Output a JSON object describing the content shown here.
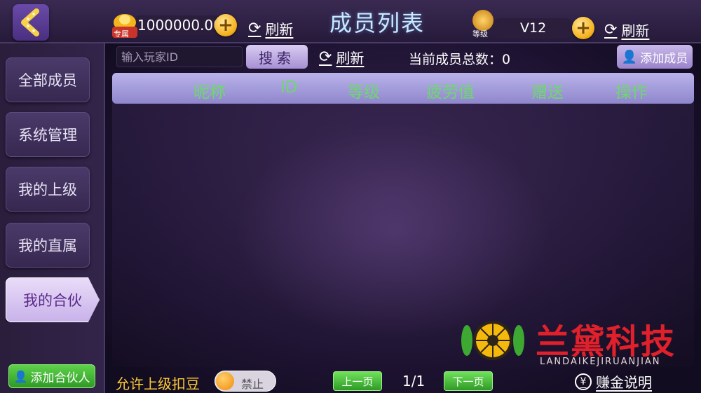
{
  "header": {
    "title": "成员列表",
    "money_tag": "专属",
    "money_value": "1000000.00",
    "refresh_label": "刷新",
    "level_tag": "等级",
    "level_value": "V12",
    "plus_symbol": "+"
  },
  "sidebar": {
    "items": [
      {
        "label": "全部成员"
      },
      {
        "label": "系统管理"
      },
      {
        "label": "我的上级"
      },
      {
        "label": "我的直属"
      },
      {
        "label": "我的合伙"
      }
    ],
    "active_index": 4
  },
  "search": {
    "placeholder": "输入玩家ID",
    "button_label": "搜索",
    "refresh_label": "刷新",
    "member_count_label": "当前成员总数：0",
    "add_member_label": "添加成员"
  },
  "table": {
    "columns": [
      "昵称",
      "ID",
      "等级",
      "疲劳值",
      "赠送",
      "操作"
    ],
    "rows": []
  },
  "footer": {
    "add_partner_label": "添加合伙人",
    "allow_label": "允许上级扣豆",
    "toggle_label": "禁止",
    "prev_label": "上一页",
    "page_indicator": "1/1",
    "next_label": "下一页",
    "earn_label": "赚金说明",
    "yen_symbol": "¥"
  },
  "watermark": {
    "name": "兰黛科技",
    "sub": "LANDAIKEJIRUANJIAN"
  },
  "colors": {
    "accent_gold": "#f5b21e",
    "header_text_green": "#6dd86d",
    "watermark_red": "#e0202a"
  }
}
